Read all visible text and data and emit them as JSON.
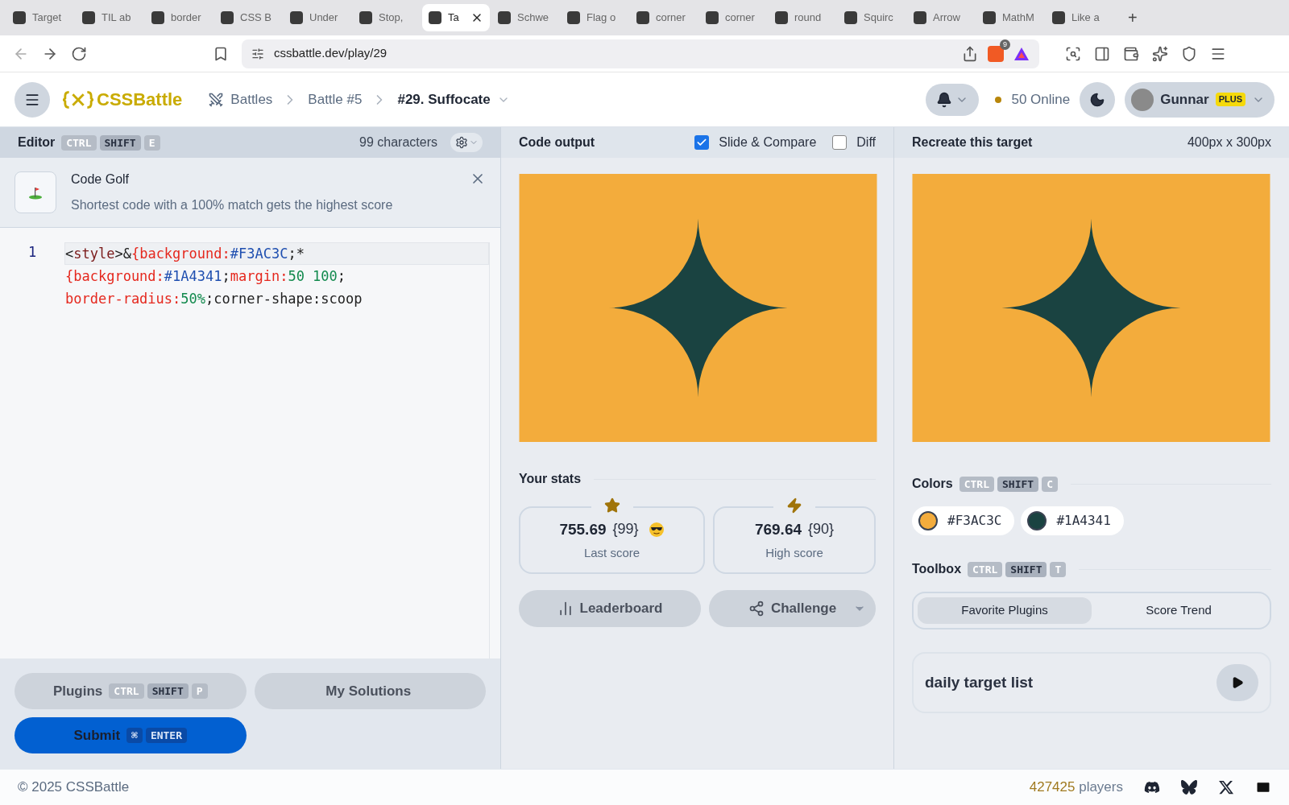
{
  "browser": {
    "tabs": [
      {
        "label": "Target",
        "selected": false
      },
      {
        "label": "TIL ab",
        "selected": false
      },
      {
        "label": "border",
        "selected": false
      },
      {
        "label": "CSS B",
        "selected": false
      },
      {
        "label": "Under",
        "selected": false
      },
      {
        "label": "Stop,",
        "selected": false
      },
      {
        "label": "Ta",
        "selected": true
      },
      {
        "label": "Schwe",
        "selected": false
      },
      {
        "label": "Flag o",
        "selected": false
      },
      {
        "label": "corner",
        "selected": false
      },
      {
        "label": "corner",
        "selected": false
      },
      {
        "label": "round",
        "selected": false
      },
      {
        "label": "Squirc",
        "selected": false
      },
      {
        "label": "Arrow",
        "selected": false
      },
      {
        "label": "MathM",
        "selected": false
      },
      {
        "label": "Like a",
        "selected": false
      }
    ],
    "new_tab": "+",
    "address": "cssbattle.dev/play/29",
    "shield_count": "9"
  },
  "header": {
    "brand": "CSSBattle",
    "breadcrumbs": [
      "Battles",
      "Battle #5",
      "#29. Suffocate"
    ],
    "online": "50 Online",
    "user": {
      "name": "Gunnar",
      "badge": "PLUS"
    }
  },
  "editor": {
    "title": "Editor",
    "shortcut": [
      {
        "label": "CTRL",
        "kind": "plain"
      },
      {
        "label": "SHIFT",
        "kind": "strong"
      },
      {
        "label": "E",
        "kind": "plain"
      }
    ],
    "char_count": "99 characters",
    "tip": {
      "title": "Code Golf",
      "text": "Shortest code with a 100% match gets the highest score"
    },
    "code": {
      "line_number": "1",
      "rows": [
        {
          "segments": [
            {
              "text": "<",
              "kind": "plain"
            },
            {
              "text": "style",
              "kind": "tag"
            },
            {
              "text": ">&",
              "kind": "plain"
            },
            {
              "text": "{background:",
              "kind": "prop"
            },
            {
              "text": "#F3AC3C",
              "kind": "value"
            },
            {
              "text": ";*",
              "kind": "plain"
            }
          ]
        },
        {
          "segments": [
            {
              "text": "{background:",
              "kind": "prop"
            },
            {
              "text": "#1A4341",
              "kind": "value"
            },
            {
              "text": ";",
              "kind": "plain"
            },
            {
              "text": "margin:",
              "kind": "prop"
            },
            {
              "text": "50 100",
              "kind": "number"
            },
            {
              "text": ";",
              "kind": "plain"
            }
          ]
        },
        {
          "segments": [
            {
              "text": "border-radius:",
              "kind": "prop"
            },
            {
              "text": "50%",
              "kind": "number"
            },
            {
              "text": ";corner-shape:scoop",
              "kind": "plain"
            }
          ]
        }
      ]
    },
    "buttons": [
      {
        "label": "Plugins",
        "kind": "secondary",
        "shortcut": [
          {
            "label": "CTRL",
            "kind": "plain"
          },
          {
            "label": "SHIFT",
            "kind": "strong"
          },
          {
            "label": "P",
            "kind": "plain"
          }
        ]
      },
      {
        "label": "My Solutions",
        "kind": "secondary"
      },
      {
        "label": "Submit",
        "kind": "primary",
        "shortcut": [
          {
            "label": "⌘",
            "kind": "accent"
          },
          {
            "label": "ENTER",
            "kind": "accent"
          }
        ]
      }
    ]
  },
  "output": {
    "title": "Code output",
    "toggles": [
      {
        "label": "Slide & Compare",
        "checked": true
      },
      {
        "label": "Diff",
        "checked": false
      }
    ],
    "stats_title": "Your stats",
    "scores": [
      {
        "value": "755.69",
        "chars": "{99}",
        "label": "Last score",
        "kind": "star",
        "emoji": true
      },
      {
        "value": "769.64",
        "chars": "{90}",
        "label": "High score",
        "kind": "bolt",
        "emoji": false
      }
    ],
    "actions": [
      {
        "label": "Leaderboard",
        "kind": "chart",
        "dropdown": false
      },
      {
        "label": "Challenge",
        "kind": "share",
        "dropdown": true
      }
    ]
  },
  "target": {
    "title": "Recreate this target",
    "size": "400px x 300px",
    "colors_title": "Colors",
    "colors_shortcut": [
      {
        "label": "CTRL",
        "kind": "plain"
      },
      {
        "label": "SHIFT",
        "kind": "strong"
      },
      {
        "label": "C",
        "kind": "plain"
      }
    ],
    "colors": [
      {
        "label": "#F3AC3C",
        "color": "#f3ac3c"
      },
      {
        "label": "#1A4341",
        "color": "#1a4341"
      }
    ],
    "toolbox_title": "Toolbox",
    "toolbox_shortcut": [
      {
        "label": "CTRL",
        "kind": "plain"
      },
      {
        "label": "SHIFT",
        "kind": "strong"
      },
      {
        "label": "T",
        "kind": "plain"
      }
    ],
    "toolbox_tabs": [
      {
        "label": "Favorite Plugins",
        "selected": true
      },
      {
        "label": "Score Trend",
        "selected": false
      }
    ],
    "daily": "daily target list"
  },
  "footer": {
    "copyright": "© 2025 CSSBattle",
    "players_count": "427425",
    "players_label": "players"
  }
}
